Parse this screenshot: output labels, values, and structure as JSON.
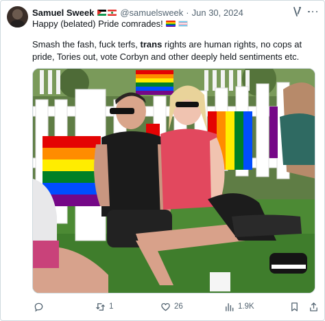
{
  "post": {
    "author": {
      "name": "Samuel Sweek",
      "handle": "@samuelsweek",
      "separator": "·",
      "date": "Jun 30, 2024",
      "name_flags": [
        "palestine-flag-icon",
        "lebanon-flag-icon"
      ]
    },
    "headline": "Happy (belated) Pride comrades!",
    "headline_emoji": [
      "rainbow-flag-icon",
      "transgender-flag-icon"
    ],
    "body": {
      "part1": "Smash the fash, fuck terfs, ",
      "bold": "trans",
      "part2": " rights are human rights, no cops at pride, Tories out, vote Corbyn and other deeply held sentiments etc."
    },
    "media": {
      "kind": "photo",
      "subject": "two people sitting on grass in front of a white picket fence with rainbow pride flags"
    },
    "actions": {
      "replies": "",
      "reposts": "1",
      "likes": "26",
      "views": "1.9K"
    },
    "colors": {
      "text": "#0f1419",
      "secondary": "#536471",
      "border": "#cfd9de"
    }
  }
}
